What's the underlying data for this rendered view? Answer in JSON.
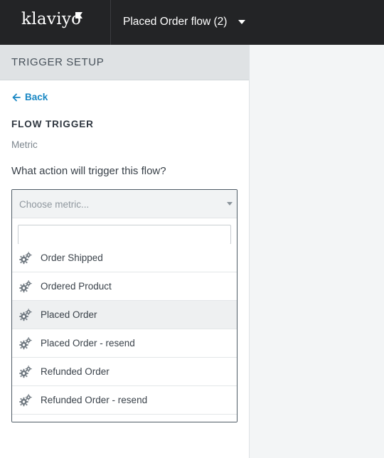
{
  "app": {
    "logo_text": "klaviyo",
    "flow_name": "Placed Order flow (2)"
  },
  "sidebar": {
    "header": "TRIGGER SETUP",
    "back_label": "Back",
    "section_title": "FLOW TRIGGER",
    "section_sub": "Metric",
    "question": "What action will trigger this flow?"
  },
  "metric_dropdown": {
    "placeholder": "Choose metric...",
    "search_value": "",
    "items": [
      {
        "label": "Order Shipped",
        "icon": "gears-icon"
      },
      {
        "label": "Ordered Product",
        "icon": "gears-icon"
      },
      {
        "label": "Placed Order",
        "icon": "gears-icon",
        "highlighted": true
      },
      {
        "label": "Placed Order - resend",
        "icon": "gears-icon"
      },
      {
        "label": "Refunded Order",
        "icon": "gears-icon"
      },
      {
        "label": "Refunded Order - resend",
        "icon": "gears-icon"
      }
    ]
  },
  "colors": {
    "topbar": "#232426",
    "link": "#1a88c4",
    "header_bg": "#dfe2e4",
    "highlight_row": "#eef0f1"
  }
}
